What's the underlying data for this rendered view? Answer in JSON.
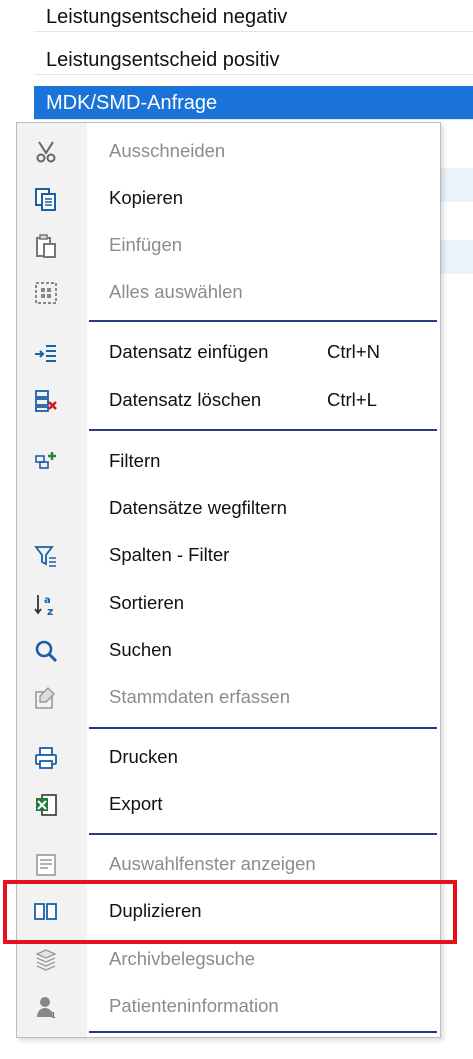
{
  "background_list": [
    {
      "label": "Leistungsentscheid negativ",
      "selected": false
    },
    {
      "label": "Leistungsentscheid positiv",
      "selected": false
    },
    {
      "label": "MDK/SMD-Anfrage",
      "selected": true
    }
  ],
  "context_menu": {
    "items": [
      {
        "label": "Ausschneiden",
        "icon": "scissors-icon",
        "disabled": true,
        "shortcut": ""
      },
      {
        "label": "Kopieren",
        "icon": "copy-icon",
        "disabled": false,
        "shortcut": ""
      },
      {
        "label": "Einfügen",
        "icon": "paste-icon",
        "disabled": true,
        "shortcut": ""
      },
      {
        "label": "Alles auswählen",
        "icon": "select-all-icon",
        "disabled": true,
        "shortcut": ""
      },
      {
        "label": "Datensatz einfügen",
        "icon": "insert-record-icon",
        "disabled": false,
        "shortcut": "Ctrl+N"
      },
      {
        "label": "Datensatz löschen",
        "icon": "delete-record-icon",
        "disabled": false,
        "shortcut": "Ctrl+L"
      },
      {
        "label": "Filtern",
        "icon": "filter-icon",
        "disabled": false,
        "shortcut": ""
      },
      {
        "label": "Datensätze wegfiltern",
        "icon": "",
        "disabled": false,
        "shortcut": ""
      },
      {
        "label": "Spalten - Filter",
        "icon": "column-filter-icon",
        "disabled": false,
        "shortcut": ""
      },
      {
        "label": "Sortieren",
        "icon": "sort-az-icon",
        "disabled": false,
        "shortcut": ""
      },
      {
        "label": "Suchen",
        "icon": "search-icon",
        "disabled": false,
        "shortcut": ""
      },
      {
        "label": "Stammdaten erfassen",
        "icon": "master-data-icon",
        "disabled": true,
        "shortcut": ""
      },
      {
        "label": "Drucken",
        "icon": "printer-icon",
        "disabled": false,
        "shortcut": ""
      },
      {
        "label": "Export",
        "icon": "excel-export-icon",
        "disabled": false,
        "shortcut": ""
      },
      {
        "label": "Auswahlfenster anzeigen",
        "icon": "selection-window-icon",
        "disabled": true,
        "shortcut": ""
      },
      {
        "label": "Duplizieren",
        "icon": "duplicate-icon",
        "disabled": false,
        "shortcut": ""
      },
      {
        "label": "Archivbelegsuche",
        "icon": "archive-search-icon",
        "disabled": true,
        "shortcut": ""
      },
      {
        "label": "Patienteninformation",
        "icon": "patient-info-icon",
        "disabled": true,
        "shortcut": ""
      }
    ]
  },
  "colors": {
    "selection": "#1a73d9",
    "separator": "#2b3a78",
    "highlight": "#e5121e",
    "disabled_text": "#8c8c8c"
  }
}
